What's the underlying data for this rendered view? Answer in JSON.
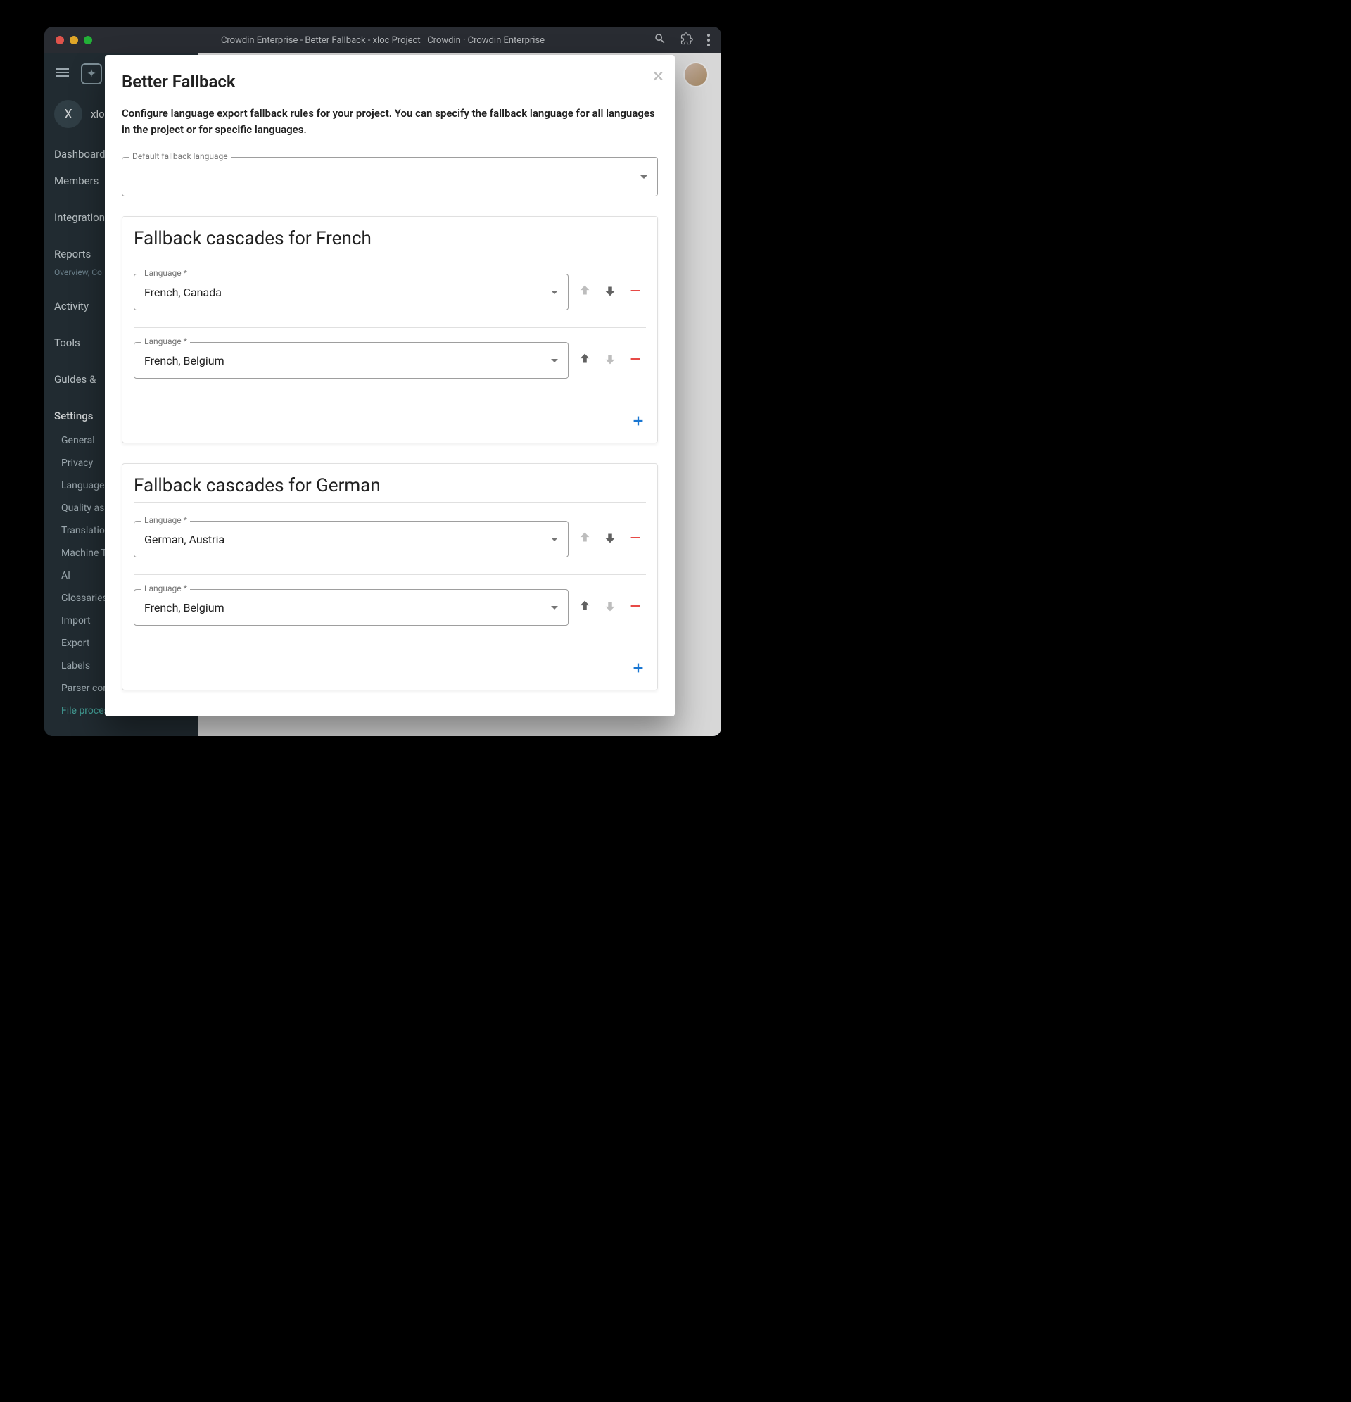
{
  "titlebar": {
    "title": "Crowdin Enterprise - Better Fallback - xloc Project | Crowdin · Crowdin Enterprise"
  },
  "sidebar": {
    "project_initial": "X",
    "project_name": "xlo",
    "nav": [
      "Dashboard",
      "Members",
      "Integration",
      "Reports",
      "Activity",
      "Tools",
      "Guides & "
    ],
    "reports_sub": "Overview, Co",
    "settings_label": "Settings",
    "settings_items": [
      "General",
      "Privacy",
      "Languages",
      "Quality ass",
      "Translation",
      "Machine T",
      "AI",
      "Glossaries",
      "Import",
      "Export",
      "Labels",
      "Parser con",
      "File processors"
    ]
  },
  "modal": {
    "title": "Better Fallback",
    "description": "Configure language export fallback rules for your project. You can specify the fallback language for all languages in the project or for specific languages.",
    "default_label": "Default fallback language",
    "default_value": "",
    "language_label": "Language *",
    "cascades": [
      {
        "title": "Fallback cascades for French",
        "rows": [
          {
            "value": "French, Canada",
            "up_disabled": true,
            "down_disabled": false
          },
          {
            "value": "French, Belgium",
            "up_disabled": false,
            "down_disabled": true
          }
        ]
      },
      {
        "title": "Fallback cascades for German",
        "rows": [
          {
            "value": "German, Austria",
            "up_disabled": true,
            "down_disabled": false
          },
          {
            "value": "French, Belgium",
            "up_disabled": false,
            "down_disabled": true
          }
        ]
      }
    ]
  }
}
